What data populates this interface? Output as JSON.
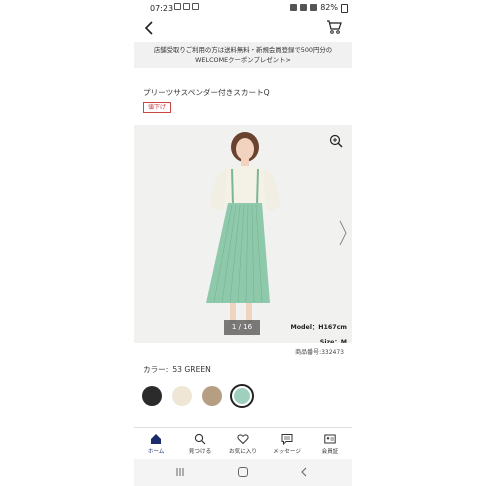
{
  "status_bar": {
    "time": "07:23",
    "battery": "82%"
  },
  "banner": {
    "line1": "店舗受取りご利用の方は送料無料・新規会員登録で500円分の",
    "line2": "WELCOMEクーポンプレゼント>"
  },
  "product": {
    "title": "プリーツサスペンダー付きスカートQ",
    "tag": "値下げ",
    "page_indicator": "1 / 16",
    "model": "Model：H167cm",
    "size": "Size：M",
    "code": "商品番号:332473"
  },
  "color": {
    "label": "カラー:",
    "selected": "53 GREEN",
    "swatches": [
      {
        "name": "black",
        "hex": "#2b2b2b"
      },
      {
        "name": "ivory",
        "hex": "#efe6d6"
      },
      {
        "name": "beige",
        "hex": "#b69e83"
      },
      {
        "name": "green",
        "hex": "#9fd0bd",
        "selected": true
      }
    ]
  },
  "nav": {
    "items": [
      {
        "label": "ホーム",
        "icon": "home-icon",
        "active": true
      },
      {
        "label": "見つける",
        "icon": "search-icon"
      },
      {
        "label": "お気に入り",
        "icon": "heart-icon"
      },
      {
        "label": "メッセージ",
        "icon": "message-icon"
      },
      {
        "label": "会員証",
        "icon": "member-card-icon"
      }
    ]
  },
  "colors": {
    "accent": "#1a2c6b",
    "tag_red": "#cc4444",
    "banner_bg": "#f1f1f1",
    "skirt_green": "#8fc9ab"
  }
}
